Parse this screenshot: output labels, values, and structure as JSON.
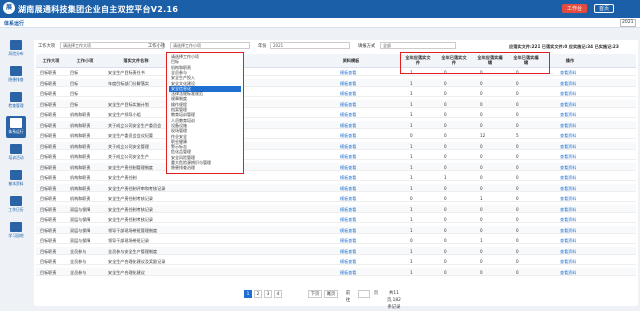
{
  "app": {
    "logo": "展",
    "title": "湖南展通科技集团企业自主双控平台V2.16",
    "buttons": [
      "工作台",
      "首页"
    ]
  },
  "page": {
    "breadcrumb": "体系运行",
    "year": "2021"
  },
  "sidebar": [
    {
      "label": "风险分布"
    },
    {
      "label": "隐患排查"
    },
    {
      "label": "检查管理"
    },
    {
      "label": "体系运行"
    },
    {
      "label": "培训活动"
    },
    {
      "label": "基本资料"
    },
    {
      "label": "工作日历"
    },
    {
      "label": "学习园地"
    }
  ],
  "filters": {
    "label1": "工作大项",
    "sel1": "请选择工作大项",
    "label2": "工作小项",
    "sel2": "请选择工作小项",
    "label3": "年份",
    "sel3": "2021",
    "label4": "填报方式",
    "sel4": "全部",
    "stats": "应落实文件:221 已落实文件:0 应实施记:34 已实施记:23"
  },
  "table": {
    "headers": [
      "工作大项",
      "工作小项",
      "落实文件名称",
      "资料模板",
      "全年应落实文件",
      "全年已落实文件",
      "全年应落实编辑",
      "全年已落实编辑",
      "操作"
    ],
    "rows": [
      [
        "目标职责",
        "目标",
        "安全生产目标责任书",
        "模板查看",
        "1",
        "0",
        "0",
        "0",
        "查看资料"
      ],
      [
        "目标职责",
        "目标",
        "年度目标部门分解落实",
        "模板查看",
        "1",
        "0",
        "0",
        "0",
        "查看资料"
      ],
      [
        "目标职责",
        "目标",
        "",
        "模板查看",
        "1",
        "0",
        "0",
        "0",
        "查看资料"
      ],
      [
        "目标职责",
        "目标",
        "安全生产目标实施计划",
        "模板查看",
        "1",
        "0",
        "0",
        "0",
        "查看资料"
      ],
      [
        "目标职责",
        "机构和职责",
        "安全生产领导小组",
        "模板查看",
        "1",
        "0",
        "0",
        "0",
        "查看资料"
      ],
      [
        "目标职责",
        "机构和职责",
        "关于成立公司安全生产委员会",
        "模板查看",
        "1",
        "0",
        "0",
        "0",
        "查看资料"
      ],
      [
        "目标职责",
        "机构和职责",
        "安全生产委员会会议纪要",
        "模板查看",
        "0",
        "0",
        "12",
        "5",
        "查看资料"
      ],
      [
        "目标职责",
        "机构和职责",
        "关于成立公司安全管理",
        "模板查看",
        "1",
        "0",
        "0",
        "0",
        "查看资料"
      ],
      [
        "目标职责",
        "机构和职责",
        "关于成立公司安全生产",
        "模板查看",
        "1",
        "0",
        "0",
        "0",
        "查看资料"
      ],
      [
        "目标职责",
        "机构和职责",
        "安全生产责任制管理制度",
        "模板查看",
        "1",
        "0",
        "0",
        "0",
        "查看资料"
      ],
      [
        "目标职责",
        "机构和职责",
        "安全生产责任制",
        "模板查看",
        "1",
        "1",
        "0",
        "0",
        "查看资料"
      ],
      [
        "目标职责",
        "机构和职责",
        "安全生产责任制评审和考核记录",
        "模板查看",
        "1",
        "0",
        "0",
        "0",
        "查看资料"
      ],
      [
        "目标职责",
        "机构和职责",
        "安全生产责任制考核记录",
        "模板查看",
        "0",
        "0",
        "1",
        "0",
        "查看资料"
      ],
      [
        "目标职责",
        "双层与保障",
        "安全生产责任制考核记录",
        "模板查看",
        "1",
        "0",
        "0",
        "0",
        "查看资料"
      ],
      [
        "目标职责",
        "双层与保障",
        "安全生产责任制考核记录",
        "模板查看",
        "1",
        "0",
        "0",
        "0",
        "查看资料"
      ],
      [
        "目标职责",
        "双层与保障",
        "领导干部现场带班管理制度",
        "模板查看",
        "1",
        "0",
        "0",
        "0",
        "查看资料"
      ],
      [
        "目标职责",
        "双层与保障",
        "领导干部现场带班记录",
        "模板查看",
        "0",
        "0",
        "1",
        "0",
        "查看资料"
      ],
      [
        "目标职责",
        "全员参与",
        "全员参与安全生产管理制度",
        "模板查看",
        "1",
        "0",
        "0",
        "0",
        "查看资料"
      ],
      [
        "目标职责",
        "全员参与",
        "安全生产合理化建议及奖励记录",
        "模板查看",
        "1",
        "0",
        "0",
        "0",
        "查看资料"
      ],
      [
        "目标职责",
        "全员参与",
        "安全生产合理化建议",
        "模板查看",
        "1",
        "0",
        "0",
        "0",
        "查看资料"
      ]
    ]
  },
  "dropdown": {
    "items": [
      "请选择工作小项",
      "目标",
      "机构和职责",
      "全员参与",
      "安全生产投入",
      "安全文化建设",
      "安全信息化",
      "法律法规标准规范",
      "规章制度",
      "操作规程",
      "档案管理",
      "教育培训管理",
      "人员教育培训",
      "设备设施",
      "现场管理",
      "作业安全",
      "职业健康",
      "警示标志",
      "危化品管理",
      "安全风险管理",
      "重大危险源辨识与管理",
      "隐患排查治理"
    ],
    "selected_index": 6
  },
  "pagination": {
    "pages": [
      "1",
      "2",
      "3",
      "4"
    ],
    "current": "1",
    "next": "下页",
    "last": "尾页",
    "goto": "前往",
    "page_unit": "页",
    "total": "共11页,182条记录"
  }
}
